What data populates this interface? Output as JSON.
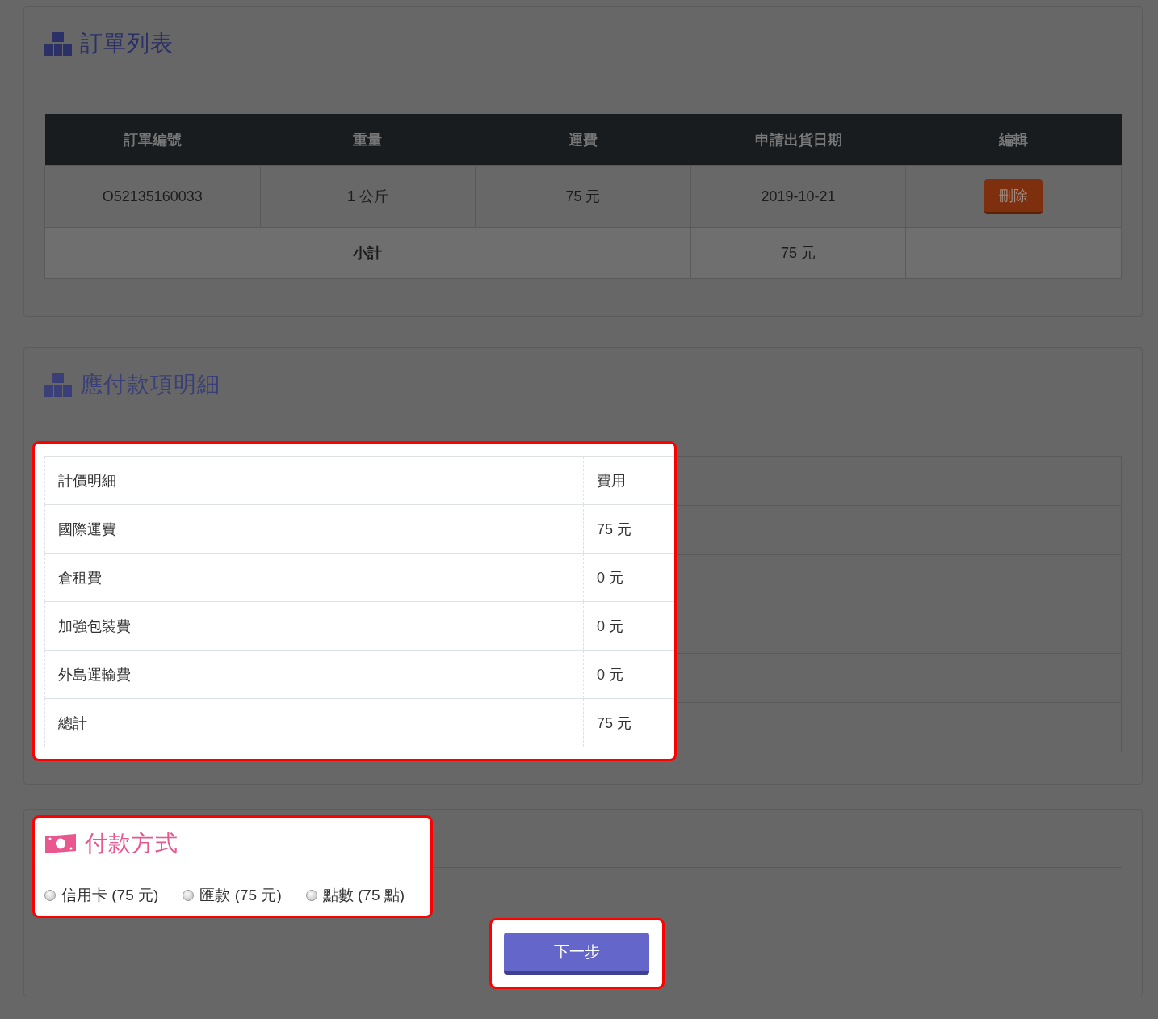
{
  "order_list": {
    "title": "訂單列表",
    "columns": [
      "訂單編號",
      "重量",
      "運費",
      "申請出貨日期",
      "編輯"
    ],
    "rows": [
      {
        "order_no": "O52135160033",
        "weight": "1 公斤",
        "shipping": "75 元",
        "ship_date": "2019-10-21",
        "action": "刪除"
      }
    ],
    "subtotal": {
      "label": "小計",
      "amount": "75 元"
    }
  },
  "payable_details": {
    "title": "應付款項明細",
    "highlighted": true,
    "header": {
      "item": "計價明細",
      "fee": "費用"
    },
    "rows": [
      {
        "item": "國際運費",
        "fee": "75 元"
      },
      {
        "item": "倉租費",
        "fee": "0 元"
      },
      {
        "item": "加強包裝費",
        "fee": "0 元"
      },
      {
        "item": "外島運輸費",
        "fee": "0 元"
      },
      {
        "item": "總計",
        "fee": "75 元"
      }
    ]
  },
  "payment": {
    "title": "付款方式",
    "highlighted": true,
    "options": [
      {
        "label": "信用卡 (75 元)",
        "selected": false
      },
      {
        "label": "匯款 (75 元)",
        "selected": false
      },
      {
        "label": "點數 (75 點)",
        "selected": false
      }
    ]
  },
  "next_button": {
    "label": "下一步",
    "highlighted": true
  }
}
